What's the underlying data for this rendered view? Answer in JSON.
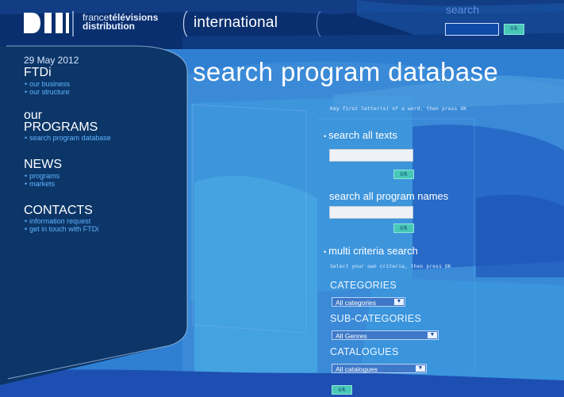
{
  "header": {
    "brand_line1_light": "france",
    "brand_line1_bold": "télévisions",
    "brand_line2": "distribution",
    "site_section": "international",
    "search_label": "search",
    "search_value": "",
    "search_ok": "ok"
  },
  "sidebar": {
    "date": "29 May 2012",
    "sections": [
      {
        "title_lines": [
          "FTDi"
        ],
        "items": [
          "our business",
          "our structure"
        ]
      },
      {
        "title_lines": [
          "our",
          "PROGRAMS"
        ],
        "items": [
          "search program database"
        ]
      },
      {
        "title_lines": [
          "NEWS"
        ],
        "items": [
          "programs",
          "markets"
        ]
      },
      {
        "title_lines": [
          "CONTACTS"
        ],
        "items": [
          "information request",
          "get in touch with FTDi"
        ]
      }
    ]
  },
  "main": {
    "title": "search program database",
    "hint1": "Key first letter(s) of a word, then press OK",
    "search_texts_label": "search all texts",
    "search_texts_value": "",
    "search_texts_ok": "ok",
    "search_names_label": "search all program names",
    "search_names_value": "",
    "search_names_ok": "ok",
    "multi_label": "multi criteria search",
    "hint2": "Select your own criteria, then press OK",
    "categories_label": "CATEGORIES",
    "categories_selected": "All categories",
    "subcategories_label": "SUB-CATEGORIES",
    "subcategories_selected": "All Genres",
    "catalogues_label": "CATALOGUES",
    "catalogues_selected": "All catalogues",
    "final_ok": "ok"
  },
  "colors": {
    "header_bg": "#0a2f6e",
    "sidebar_bg": "#0c3668",
    "main_bg": "#2f7fd3",
    "ok_button": "#48c8b8",
    "link": "#5fb4ff"
  }
}
